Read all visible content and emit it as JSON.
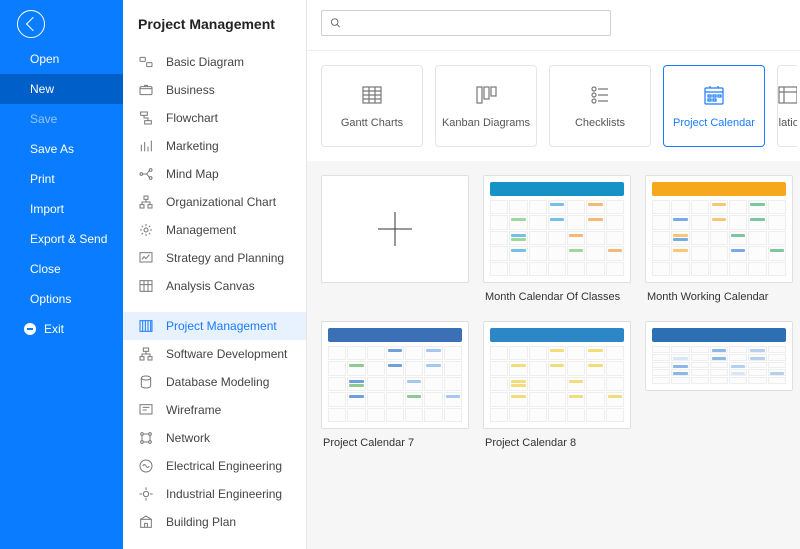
{
  "sidebar": {
    "items": [
      {
        "label": "Open",
        "dim": false,
        "selected": false
      },
      {
        "label": "New",
        "dim": false,
        "selected": true
      },
      {
        "label": "Save",
        "dim": true,
        "selected": false
      },
      {
        "label": "Save As",
        "dim": false,
        "selected": false
      },
      {
        "label": "Print",
        "dim": false,
        "selected": false
      },
      {
        "label": "Import",
        "dim": false,
        "selected": false
      },
      {
        "label": "Export & Send",
        "dim": false,
        "selected": false
      },
      {
        "label": "Close",
        "dim": false,
        "selected": false
      },
      {
        "label": "Options",
        "dim": false,
        "selected": false
      }
    ],
    "exit_label": "Exit"
  },
  "page_title": "Project Management",
  "types": {
    "group1": [
      {
        "label": "Basic Diagram"
      },
      {
        "label": "Business"
      },
      {
        "label": "Flowchart"
      },
      {
        "label": "Marketing"
      },
      {
        "label": "Mind Map"
      },
      {
        "label": "Organizational Chart"
      },
      {
        "label": "Management"
      },
      {
        "label": "Strategy and Planning"
      },
      {
        "label": "Analysis Canvas"
      }
    ],
    "group2": [
      {
        "label": "Project Management",
        "selected": true
      },
      {
        "label": "Software Development"
      },
      {
        "label": "Database Modeling"
      },
      {
        "label": "Wireframe"
      },
      {
        "label": "Network"
      },
      {
        "label": "Electrical Engineering"
      },
      {
        "label": "Industrial Engineering"
      },
      {
        "label": "Building Plan"
      }
    ]
  },
  "search": {
    "placeholder": ""
  },
  "tabs": [
    {
      "label": "Gantt Charts"
    },
    {
      "label": "Kanban Diagrams"
    },
    {
      "label": "Checklists"
    },
    {
      "label": "Project Calendar",
      "selected": true
    },
    {
      "label": "Relations"
    }
  ],
  "gallery": {
    "row1": [
      {
        "label": "",
        "blank": true
      },
      {
        "label": "Month Calendar Of Classes",
        "head": "#1693c4",
        "c1": "#74c0e6",
        "c2": "#f5b971",
        "c3": "#9fd89f"
      },
      {
        "label": "",
        "head": "#f7a71b",
        "c1": "#f7c873",
        "c2": "#7cc6a0",
        "c3": "#7aa9e9",
        "partial_below": true
      }
    ],
    "row1_wide_label": "Month Working Calendar",
    "row2": [
      {
        "label": "Project Calendar 7",
        "head": "#3b6fb6",
        "c1": "#6fa0de",
        "c2": "#a6c8ee",
        "c3": "#8fc98f"
      },
      {
        "label": "Project Calendar 8",
        "head": "#2d87c7",
        "c1": "#f1dd7a",
        "c2": "#f1dd7a",
        "c3": "#f1dd7a"
      },
      {
        "label": "",
        "head": "#2d6fb3",
        "c1": "#8db7e6",
        "c2": "#b3d0ee",
        "c3": "#d8e7f7",
        "partial": true
      }
    ]
  }
}
